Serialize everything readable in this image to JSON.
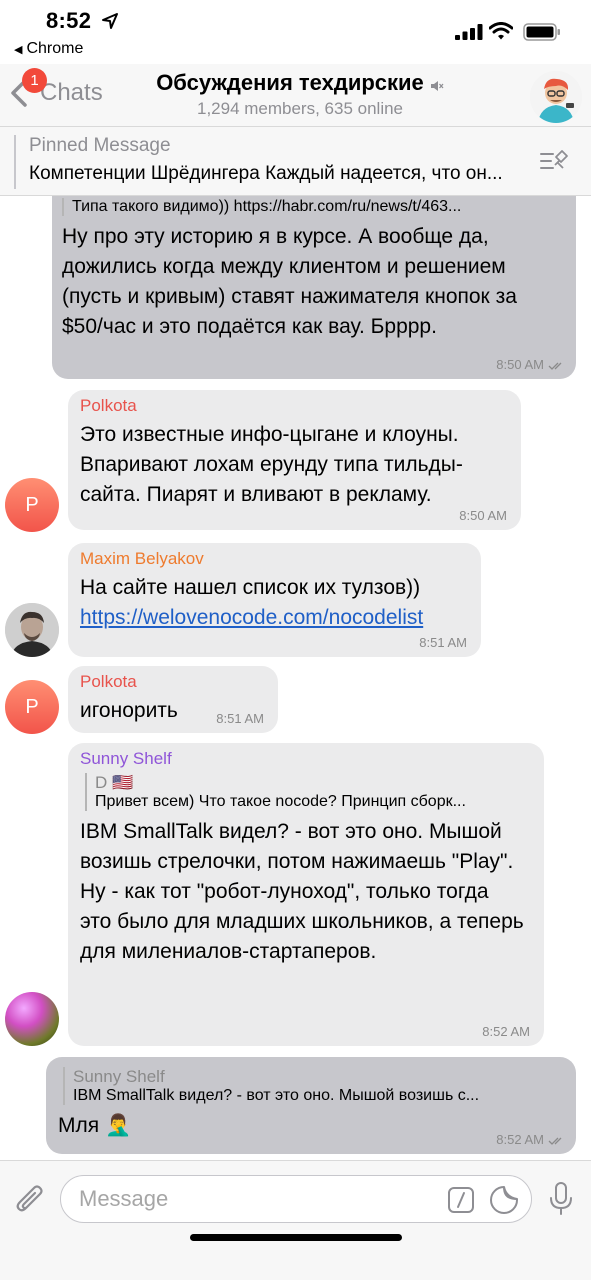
{
  "status_bar": {
    "time": "8:52",
    "back_app": "Chrome"
  },
  "header": {
    "back_label": "Chats",
    "unread_count": "1",
    "title": "Обсуждения техдирские",
    "subtitle": "1,294 members, 635 online"
  },
  "pinned": {
    "label": "Pinned Message",
    "text": "Компетенции Шрёдингера Каждый надеется, что он..."
  },
  "messages": [
    {
      "direction": "out",
      "reply_text": "Типа такого видимо)) https://habr.com/ru/news/t/463...",
      "text": "Ну про эту историю я в курсе. А вообще да, дожились когда между клиентом и решением (пусть и кривым) ставят нажимателя кнопок за $50/час и это подаётся как вау. Брррр.",
      "time": "8:50 AM"
    },
    {
      "direction": "in",
      "sender": "Polkota",
      "sender_color": "#e8534c",
      "text": "Это известные инфо-цыгане и клоуны. Впаривают лохам ерунду типа тильды-сайта. Пиарят и вливают в рекламу.",
      "time": "8:50 AM",
      "avatar_letter": "P"
    },
    {
      "direction": "in",
      "sender": "Maxim Belyakov",
      "sender_color": "#ee7b2e",
      "text": "На сайте нашел список их тулзов))",
      "link": "https://welovenocode.com/nocodelist",
      "time": "8:51 AM"
    },
    {
      "direction": "in",
      "sender": "Polkota",
      "sender_color": "#e8534c",
      "text": "игонорить",
      "time": "8:51 AM",
      "avatar_letter": "P"
    },
    {
      "direction": "in",
      "sender": "Sunny Shelf",
      "sender_color": "#8f55d8",
      "reply_name": "D 🇺🇸",
      "reply_text": "Привет всем) Что такое nocode? Принцип сборк...",
      "text": "IBM SmallTalk видел? - вот это оно. Мышой возишь стрелочки, потом нажимаешь \"Play\". Ну - как тот \"робот-луноход\", только тогда это было для младших школьников, а теперь для милениалов-стартаперов.",
      "time": "8:52 AM"
    },
    {
      "direction": "out",
      "reply_name": "Sunny Shelf",
      "reply_text": "IBM SmallTalk видел? - вот это оно. Мышой возишь с...",
      "text": "Мля 🤦‍♂️",
      "time": "8:52 AM"
    }
  ],
  "input": {
    "placeholder": "Message"
  },
  "colors": {
    "incoming_bubble": "#ebebec",
    "outgoing_bubble": "#c7c7cc",
    "badge": "#f2493a",
    "link": "#1f5fc7"
  },
  "icons": [
    "location-arrow-icon",
    "signal-icon",
    "wifi-icon",
    "battery-icon",
    "back-chevron-icon",
    "mute-icon",
    "pin-list-icon",
    "read-ticks-icon",
    "attach-icon",
    "command-icon",
    "sticker-icon",
    "mic-icon"
  ]
}
